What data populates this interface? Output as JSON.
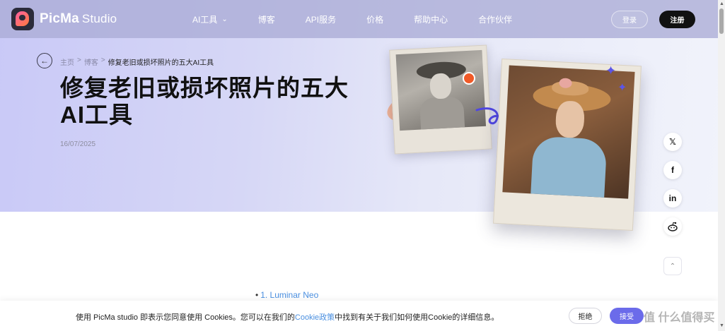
{
  "brand": {
    "name": "PicMa",
    "suffix": "Studio"
  },
  "nav": {
    "items": [
      {
        "label": "AI工具",
        "has_dropdown": true
      },
      {
        "label": "博客"
      },
      {
        "label": "API服务"
      },
      {
        "label": "价格"
      },
      {
        "label": "帮助中心"
      },
      {
        "label": "合作伙伴"
      }
    ],
    "login_label": "登录",
    "signup_label": "注册"
  },
  "breadcrumb": {
    "home": "主页",
    "blog": "博客",
    "current": "修复老旧或损坏照片的五大AI工具",
    "sep": ">"
  },
  "article": {
    "title": "修复老旧或损坏照片的五大AI工具",
    "date": "16/07/2025"
  },
  "social": {
    "x": "𝕏",
    "facebook": "f",
    "linkedin": "in",
    "reddit": "reddit-icon"
  },
  "toc": {
    "first_item": "1. Luminar Neo",
    "bullet": "•"
  },
  "cookie": {
    "text_before": "使用 PicMa studio 即表示您同意使用 Cookies。您可以在我们的",
    "link": "Cookie政策",
    "text_after": "中找到有关于我们如何使用Cookie的详细信息。",
    "reject_label": "拒绝",
    "accept_label": "接受"
  },
  "watermark": "值 什么值得买",
  "colors": {
    "accent": "#6b6bea",
    "link": "#4a8fe0",
    "signup_bg": "#111111"
  }
}
